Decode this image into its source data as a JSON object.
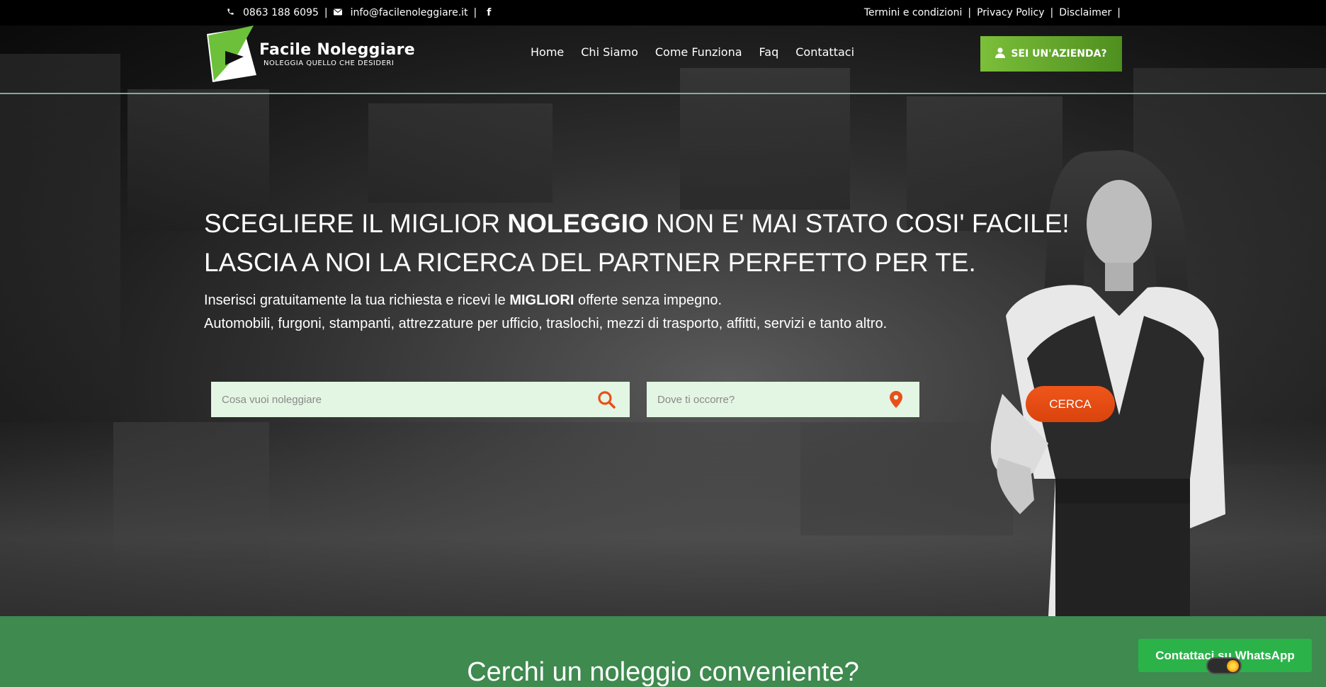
{
  "topbar": {
    "phone": "0863 188 6095",
    "email": "info@facilenoleggiare.it",
    "separator": "|",
    "facebook_glyph": "f",
    "links": [
      "Termini e condizioni",
      "Privacy Policy",
      "Disclaimer"
    ]
  },
  "header": {
    "brand": "Facile Noleggiare",
    "tagline": "NOLEGGIA QUELLO CHE DESIDERI",
    "nav": [
      "Home",
      "Chi Siamo",
      "Come Funziona",
      "Faq",
      "Contattaci"
    ],
    "company_button": "SEI UN'AZIENDA?"
  },
  "hero": {
    "line1_pre": "SCEGLIERE IL MIGLIOR ",
    "line1_bold": "NOLEGGIO",
    "line1_post": " NON E' MAI STATO COSI' FACILE!",
    "line2": "LASCIA A NOI LA RICERCA DEL PARTNER PERFETTO PER TE.",
    "sub_pre": "Inserisci gratuitamente la tua richiesta e ricevi le ",
    "sub_bold": "MIGLIORI",
    "sub_post": " offerte senza impegno.",
    "sub_line2": "Automobili, furgoni, stampanti, attrezzature per ufficio, traslochi, mezzi di trasporto, affitti, servizi e tanto altro."
  },
  "search": {
    "what_placeholder": "Cosa vuoi noleggiare",
    "where_placeholder": "Dove ti occorre?",
    "button": "CERCA"
  },
  "section": {
    "title": "Cerchi un noleggio conveniente?"
  },
  "whatsapp": {
    "label": "Contattaci su WhatsApp"
  },
  "colors": {
    "accent_orange": "#e8501a",
    "brand_green": "#6cb33f",
    "section_green": "#3f8a4f",
    "whatsapp_green": "#2bb34a"
  },
  "icons": [
    "phone-icon",
    "mail-icon",
    "facebook-icon",
    "user-icon",
    "search-icon",
    "location-pin-icon"
  ]
}
